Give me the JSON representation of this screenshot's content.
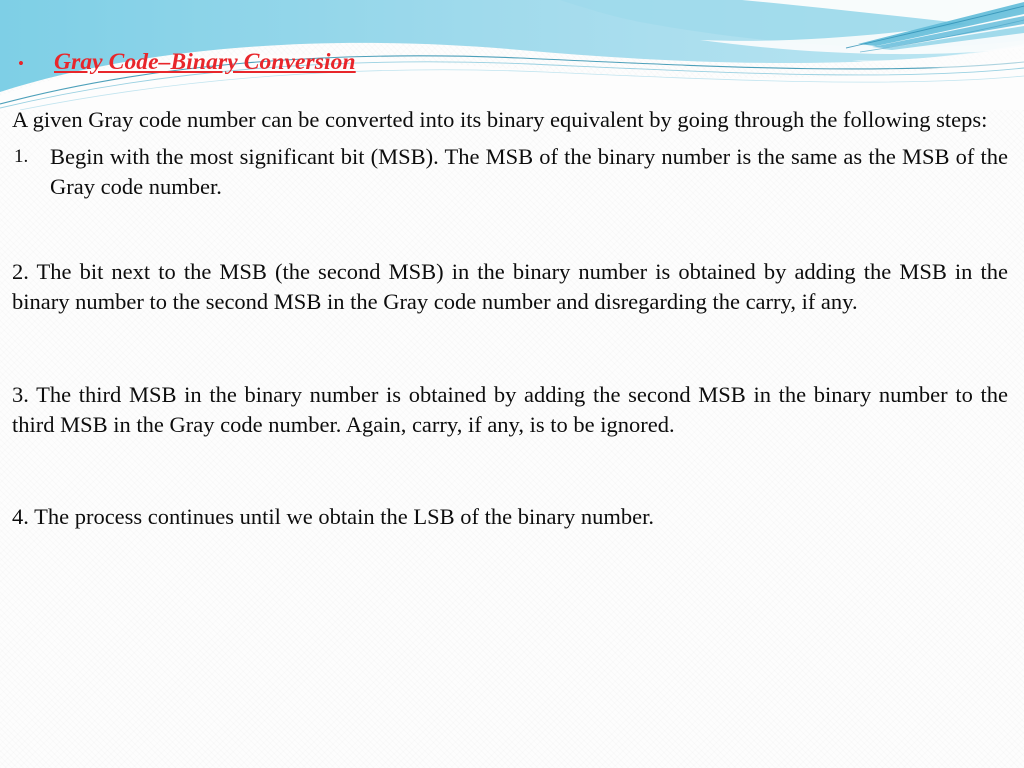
{
  "slide": {
    "background_color": "#fdfdfd",
    "accent_color": "#e8262b",
    "banner_color_light": "#bde4ef",
    "banner_color_mid": "#7fcee4",
    "banner_color_deep": "#4ab4d6"
  },
  "title": {
    "bullet": "•",
    "text": "Gray Code–Binary Conversion"
  },
  "body": {
    "intro": "A given Gray code number can be converted into its binary equivalent by going through the following steps:",
    "step1_marker": "1.",
    "step1": "Begin with the most significant bit (MSB). The MSB of the binary number is the same as the MSB of the Gray code number.",
    "step2": "2. The bit next to the MSB (the second MSB) in the binary number is obtained by adding the MSB in the binary number to the second MSB in the Gray code number and disregarding the carry, if any.",
    "step3": "3. The third MSB in the binary number is obtained by adding the second MSB in the binary number to the third MSB in the Gray code number. Again, carry, if any, is to be ignored.",
    "step4": "4. The process continues until we obtain the LSB of the binary number."
  }
}
